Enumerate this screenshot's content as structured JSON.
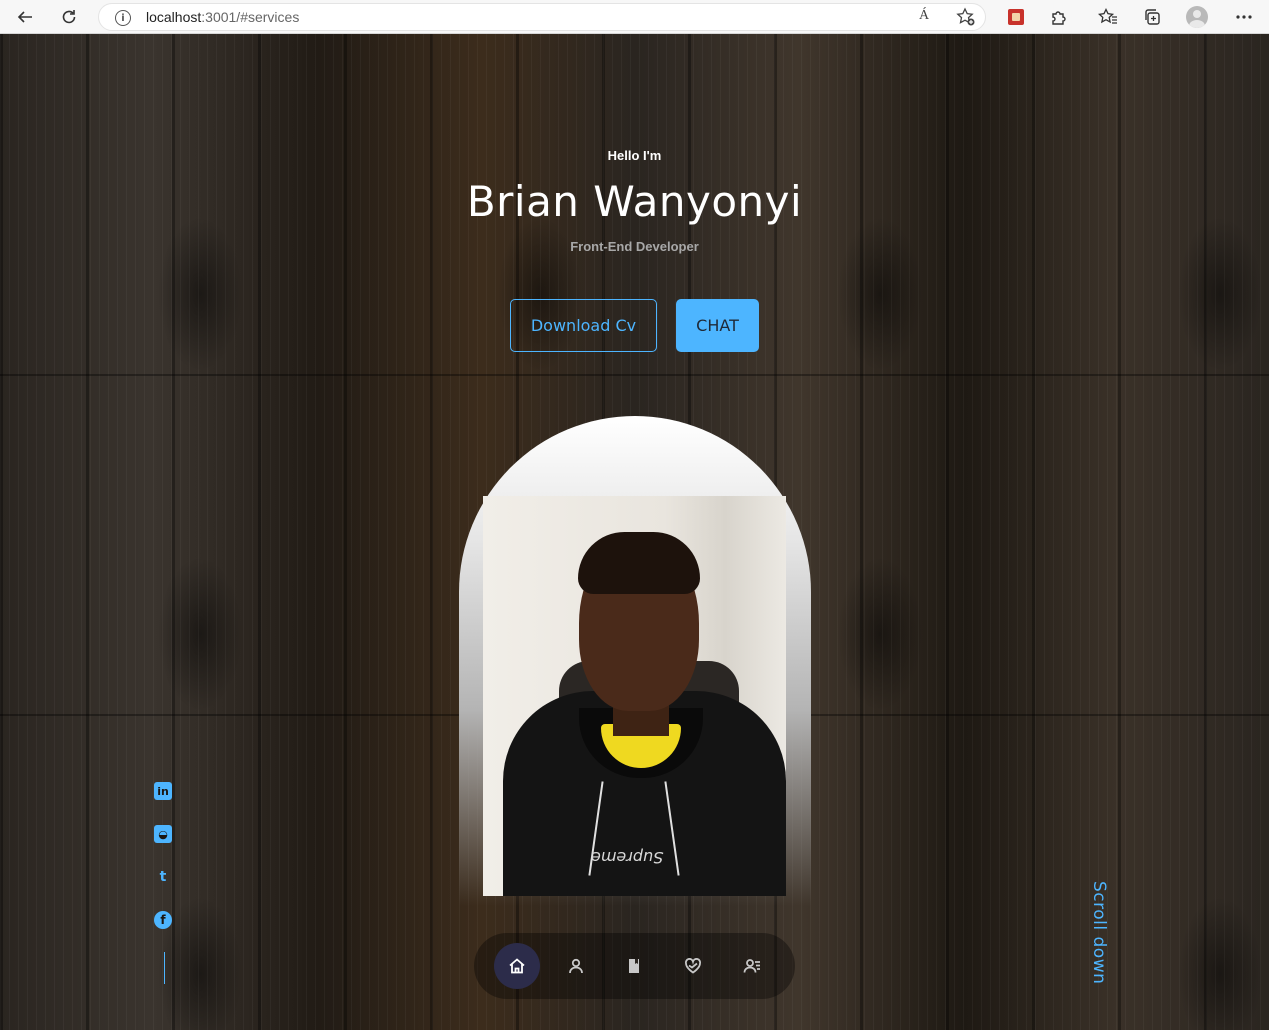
{
  "browser": {
    "url_host": "localhost",
    "url_path": ":3001/#services",
    "read_aloud": "Á",
    "icons": [
      "back-icon",
      "reload-icon",
      "info-icon",
      "read-aloud-icon",
      "add-favorite-icon",
      "extension-icon",
      "puzzle-icon",
      "favorites-icon",
      "collections-icon",
      "profile-avatar",
      "more-icon"
    ]
  },
  "hero": {
    "greeting": "Hello I'm",
    "name": "Brian Wanyonyi",
    "role": "Front-End Developer",
    "download_label": "Download Cv",
    "chat_label": "CHAT"
  },
  "photo": {
    "shirt_text": "Supreme"
  },
  "socials": {
    "icons": [
      "linkedin-icon",
      "github-icon",
      "twitter-icon",
      "facebook-icon"
    ],
    "linkedin_glyph": "in",
    "github_glyph": "◒",
    "twitter_glyph": "t",
    "facebook_glyph": "f"
  },
  "scroll_label": "Scroll down",
  "nav": {
    "items": [
      "home",
      "about",
      "experience",
      "services",
      "contact"
    ],
    "active": "home"
  },
  "colors": {
    "accent": "#4db5ff",
    "nav_active": "#2c2c4a",
    "text_light": "#ffffff",
    "text_muted": "#a8a8a8"
  }
}
